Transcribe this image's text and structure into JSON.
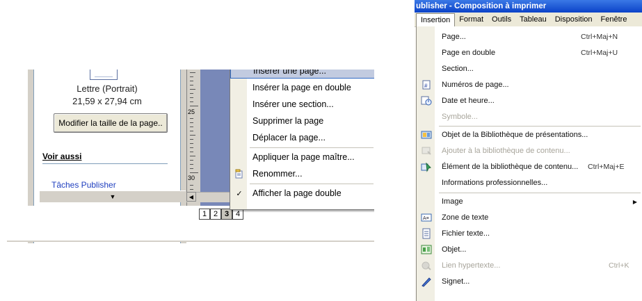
{
  "left_panel": {
    "paper_name": "Lettre (Portrait)",
    "paper_dimensions": "21,59 x 27,94 cm",
    "resize_button": "Modifier la taille de la page..",
    "see_also": "Voir aussi",
    "publisher_tasks_link": "Tâches Publisher",
    "ruler_numbers": [
      "25",
      "30"
    ],
    "page_tabs": [
      "1",
      "2",
      "3",
      "4"
    ],
    "active_page": "3",
    "context_menu": [
      {
        "label": "Insérer une page...",
        "hover": true,
        "icon": ""
      },
      {
        "label": "Insérer la page en double",
        "icon": ""
      },
      {
        "label": "Insérer une section...",
        "icon": ""
      },
      {
        "label": "Supprimer la page",
        "icon": ""
      },
      {
        "label": "Déplacer la page...",
        "icon": ""
      },
      {
        "label": "Appliquer la page maître...",
        "icon": ""
      },
      {
        "label": "Renommer...",
        "icon": "rename-icon"
      },
      {
        "label": "Afficher la page double",
        "icon": "checkmark-icon",
        "checked": true
      }
    ]
  },
  "right_panel": {
    "title": "ublisher - Composition à imprimer",
    "menu_bar": [
      "Insertion",
      "Format",
      "Outils",
      "Tableau",
      "Disposition",
      "Fenêtre"
    ],
    "active_menu": "Insertion",
    "dropdown": [
      {
        "label": "Page...",
        "shortcut": "Ctrl+Maj+N"
      },
      {
        "label": "Page en double",
        "shortcut": "Ctrl+Maj+U"
      },
      {
        "label": "Section..."
      },
      {
        "label": "Numéros de page...",
        "icon": "page-number-icon"
      },
      {
        "label": "Date et heure...",
        "icon": "date-time-icon"
      },
      {
        "label": "Symbole...",
        "disabled": true
      },
      {
        "label": "Objet de la Bibliothèque de présentations...",
        "icon": "design-gallery-icon",
        "sep_before": true
      },
      {
        "label": "Ajouter à la bibliothèque de contenu...",
        "icon": "add-library-icon",
        "disabled": true
      },
      {
        "label": "Élément de la bibliothèque de contenu...",
        "shortcut": "Ctrl+Maj+E",
        "icon": "content-library-icon"
      },
      {
        "label": "Informations professionnelles..."
      },
      {
        "label": "Image",
        "submenu": true,
        "sep_before": true
      },
      {
        "label": "Zone de texte",
        "icon": "text-box-icon"
      },
      {
        "label": "Fichier texte...",
        "icon": "text-file-icon"
      },
      {
        "label": "Objet...",
        "icon": "object-icon"
      },
      {
        "label": "Lien hypertexte...",
        "shortcut": "Ctrl+K",
        "icon": "hyperlink-icon",
        "disabled": true
      },
      {
        "label": "Signet...",
        "icon": "bookmark-icon"
      }
    ]
  },
  "colors": {
    "title_bar": "#0b42c8",
    "menu_bg": "#ece9d8",
    "hover": "#c2cbe0",
    "link": "#1f3fbf",
    "doc_area": "#7888b8"
  }
}
